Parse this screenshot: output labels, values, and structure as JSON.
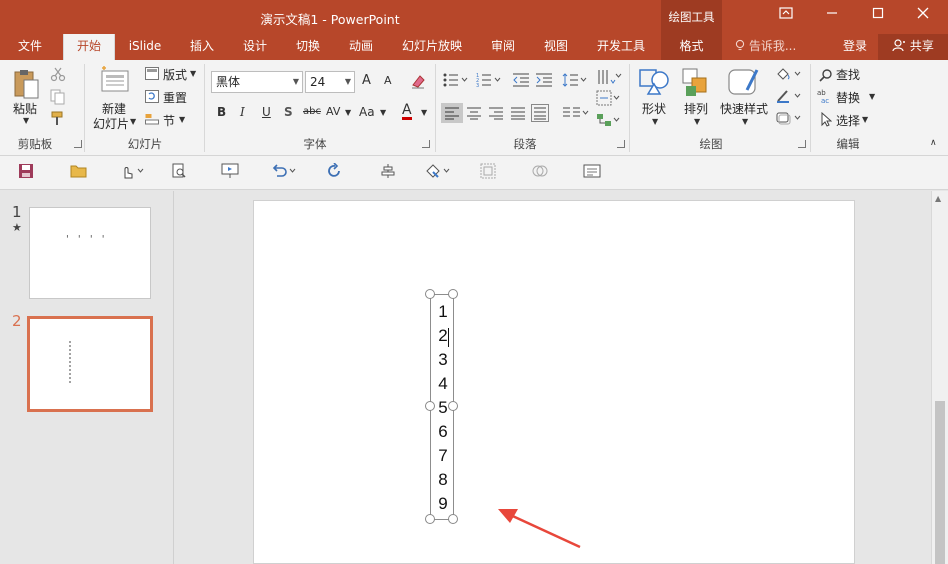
{
  "titlebar": {
    "title": "演示文稿1 - PowerPoint",
    "context_label": "绘图工具",
    "icons": [
      "ribbon-display-icon",
      "minimize-icon",
      "maximize-icon",
      "close-icon"
    ]
  },
  "tabs": [
    {
      "label": "文件"
    },
    {
      "label": "开始"
    },
    {
      "label": "iSlide"
    },
    {
      "label": "插入"
    },
    {
      "label": "设计"
    },
    {
      "label": "切换"
    },
    {
      "label": "动画"
    },
    {
      "label": "幻灯片放映"
    },
    {
      "label": "审阅"
    },
    {
      "label": "视图"
    },
    {
      "label": "开发工具"
    },
    {
      "label": "格式"
    }
  ],
  "tellme": "告诉我...",
  "login": "登录",
  "share": "共享",
  "ribbon": {
    "clipboard": {
      "label": "剪贴板",
      "paste": "粘贴"
    },
    "slides": {
      "label": "幻灯片",
      "new_slide_1": "新建",
      "new_slide_2": "幻灯片",
      "layout": "版式",
      "reset": "重置",
      "section": "节"
    },
    "font": {
      "label": "字体",
      "font_name": "黑体",
      "font_size": "24",
      "bold": "B",
      "italic": "I",
      "underline": "U",
      "shadow": "S",
      "strike": "abc",
      "spacing": "AV",
      "case": "Aa",
      "color": "A",
      "grow": "A",
      "shrink": "A"
    },
    "paragraph": {
      "label": "段落"
    },
    "drawing": {
      "label": "绘图",
      "shape": "形状",
      "arrange": "排列",
      "quick_styles": "快速样式"
    },
    "editing": {
      "label": "编辑",
      "find": "查找",
      "replace": "替换",
      "select": "选择"
    }
  },
  "thumbnails": [
    {
      "number": "1",
      "star": "★",
      "preview": "' ' ' '"
    },
    {
      "number": "2",
      "star": "",
      "preview": ""
    }
  ],
  "slide": {
    "textbox_lines": [
      "1",
      "2",
      "3",
      "4",
      "5",
      "6",
      "7",
      "8",
      "9"
    ]
  },
  "colors": {
    "accent": "#b7472a",
    "context": "#9e3b22",
    "arrow": "#e8473b",
    "selected_thumb": "#d9714f"
  }
}
